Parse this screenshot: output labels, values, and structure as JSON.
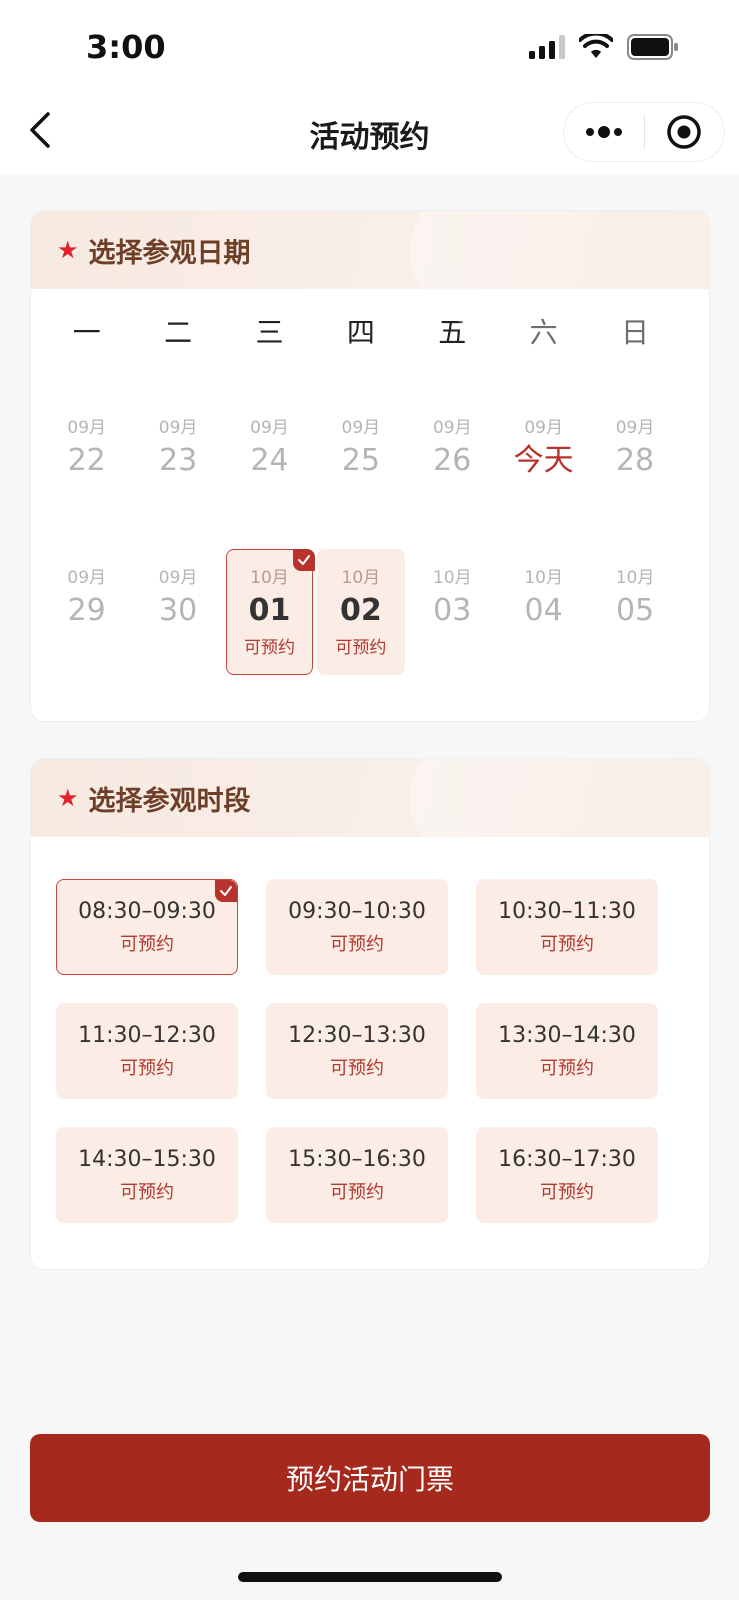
{
  "status_bar": {
    "time": "3:00"
  },
  "nav": {
    "title": "活动预约"
  },
  "date_section": {
    "title": "选择参观日期",
    "weekdays": [
      "一",
      "二",
      "三",
      "四",
      "五",
      "六",
      "日"
    ],
    "rows": [
      [
        {
          "month": "09月",
          "day": "22"
        },
        {
          "month": "09月",
          "day": "23"
        },
        {
          "month": "09月",
          "day": "24"
        },
        {
          "month": "09月",
          "day": "25"
        },
        {
          "month": "09月",
          "day": "26"
        },
        {
          "month": "09月",
          "day": "今天"
        },
        {
          "month": "09月",
          "day": "28"
        }
      ],
      [
        {
          "month": "09月",
          "day": "29"
        },
        {
          "month": "09月",
          "day": "30"
        },
        {
          "month": "10月",
          "day": "01",
          "status": "可预约"
        },
        {
          "month": "10月",
          "day": "02",
          "status": "可预约"
        },
        {
          "month": "10月",
          "day": "03"
        },
        {
          "month": "10月",
          "day": "04"
        },
        {
          "month": "10月",
          "day": "05"
        }
      ]
    ]
  },
  "time_section": {
    "title": "选择参观时段",
    "slots": [
      {
        "time": "08:30–09:30",
        "status": "可预约"
      },
      {
        "time": "09:30–10:30",
        "status": "可预约"
      },
      {
        "time": "10:30–11:30",
        "status": "可预约"
      },
      {
        "time": "11:30–12:30",
        "status": "可预约"
      },
      {
        "time": "12:30–13:30",
        "status": "可预约"
      },
      {
        "time": "13:30–14:30",
        "status": "可预约"
      },
      {
        "time": "14:30–15:30",
        "status": "可预约"
      },
      {
        "time": "15:30–16:30",
        "status": "可预约"
      },
      {
        "time": "16:30–17:30",
        "status": "可预约"
      }
    ]
  },
  "footer": {
    "button_label": "预约活动门票"
  },
  "colors": {
    "accent": "#a52a1d",
    "accent_text": "#b23a2e",
    "available_bg": "#fbece6",
    "star": "#e0242b"
  }
}
